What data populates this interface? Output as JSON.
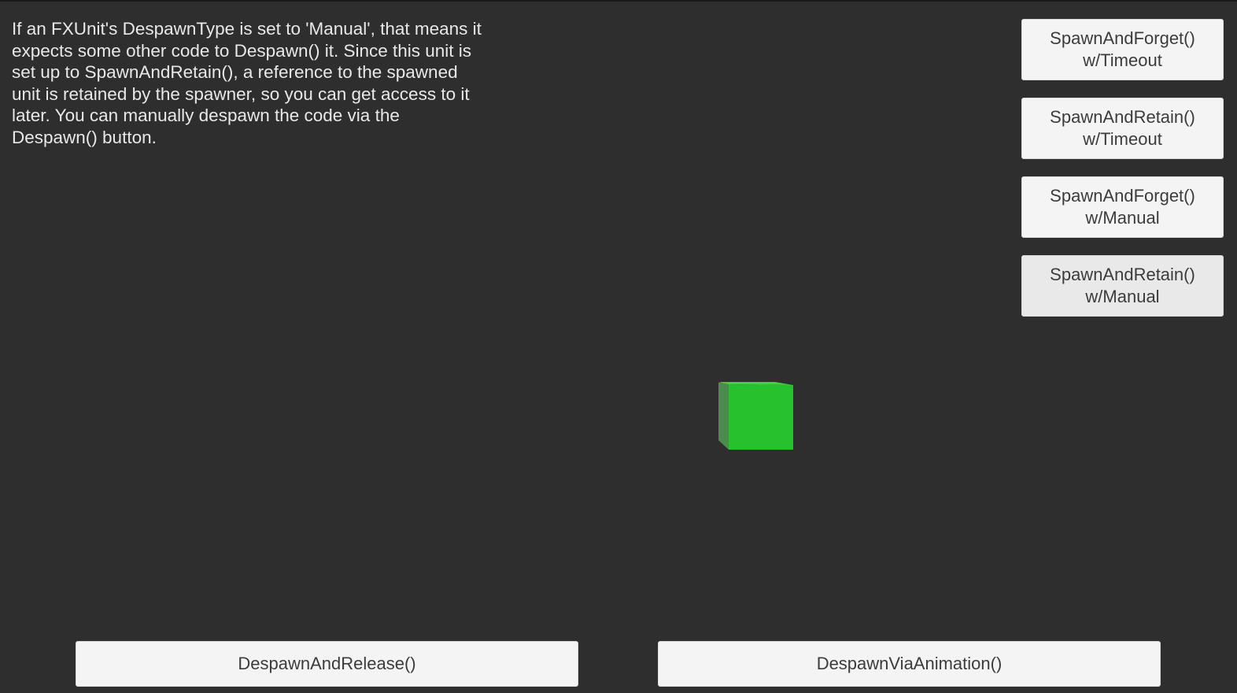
{
  "description": "If an FXUnit's DespawnType is set to 'Manual', that means it expects some other code to Despawn() it. Since this unit is set up to SpawnAndRetain(), a reference to the spawned unit is retained by the spawner, so you can get access to it later. You can manually despawn the code via the Despawn() button.",
  "spawn_buttons": [
    {
      "label": "SpawnAndForget()\nw/Timeout"
    },
    {
      "label": "SpawnAndRetain()\nw/Timeout"
    },
    {
      "label": "SpawnAndForget()\nw/Manual"
    },
    {
      "label": "SpawnAndRetain()\nw/Manual"
    }
  ],
  "bottom_buttons": {
    "despawn_release": "DespawnAndRelease()",
    "despawn_animation": "DespawnViaAnimation()"
  },
  "scene": {
    "background_color": "#2e2e2e",
    "cube_color": "#28c12e"
  }
}
